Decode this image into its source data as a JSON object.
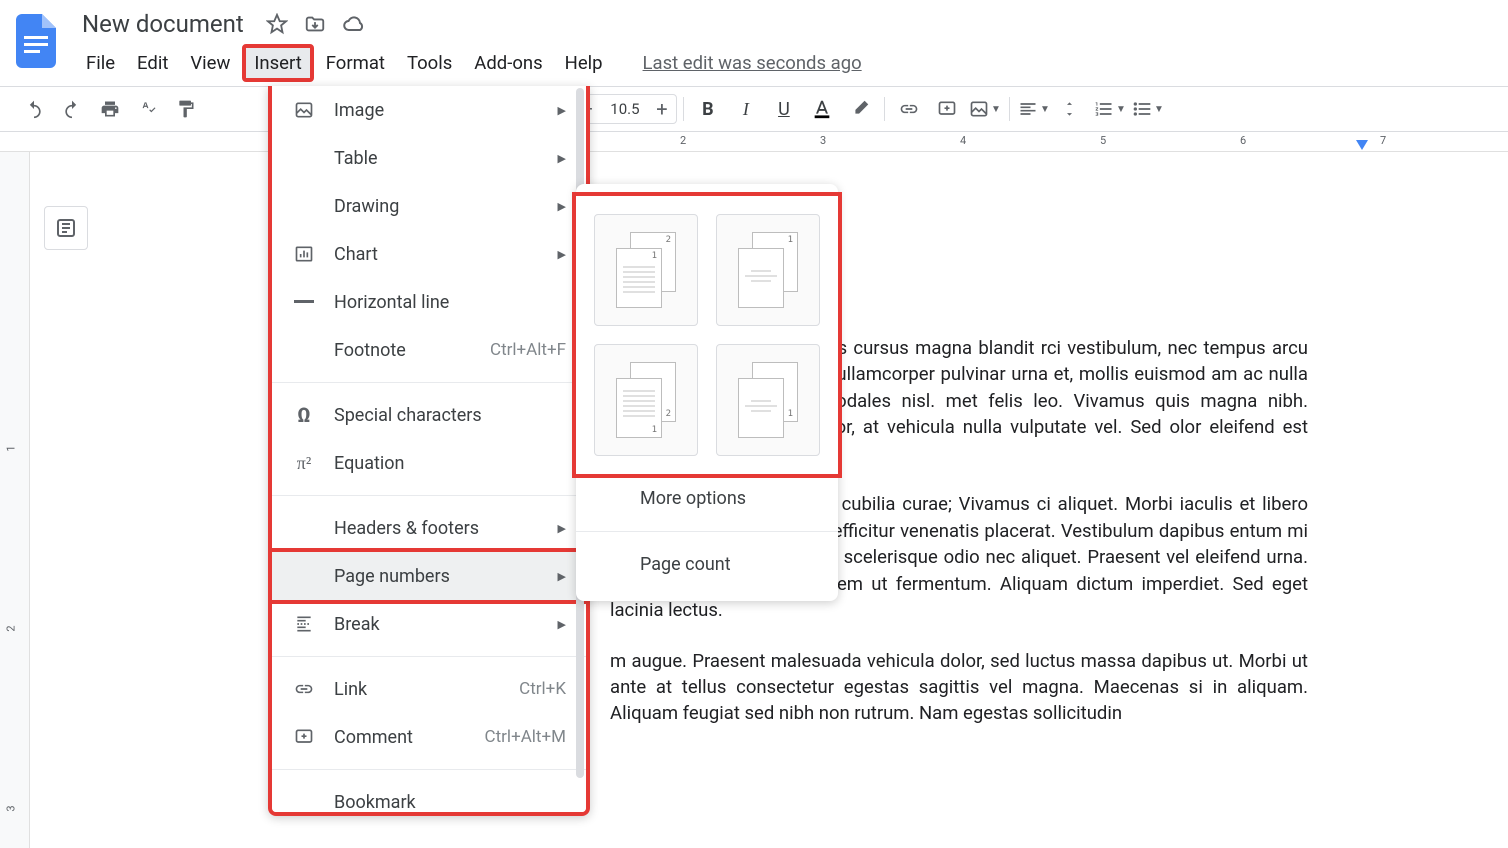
{
  "header": {
    "title": "New document",
    "last_edit": "Last edit was seconds ago"
  },
  "menus": {
    "file": "File",
    "edit": "Edit",
    "view": "View",
    "insert": "Insert",
    "format": "Format",
    "tools": "Tools",
    "addons": "Add-ons",
    "help": "Help"
  },
  "toolbar": {
    "font_size": "10.5"
  },
  "ruler": {
    "marks": [
      "2",
      "3",
      "4",
      "5",
      "6",
      "7"
    ]
  },
  "vruler": {
    "marks": [
      "1",
      "2",
      "3"
    ]
  },
  "insert_menu": {
    "image": "Image",
    "table": "Table",
    "drawing": "Drawing",
    "chart": "Chart",
    "horizontal_line": "Horizontal line",
    "footnote": "Footnote",
    "footnote_shortcut": "Ctrl+Alt+F",
    "special_chars": "Special characters",
    "equation": "Equation",
    "headers_footers": "Headers & footers",
    "page_numbers": "Page numbers",
    "break": "Break",
    "link": "Link",
    "link_shortcut": "Ctrl+K",
    "comment": "Comment",
    "comment_shortcut": "Ctrl+Alt+M",
    "bookmark": "Bookmark"
  },
  "submenu": {
    "more_options": "More options",
    "page_count": "Page count"
  },
  "document": {
    "p1": "iscing elit. Praesent rhoncus cursus magna blandit rci vestibulum, nec tempus arcu convallis. Praesent s nunc, ullamcorper pulvinar urna et, mollis euismod am ac nulla pharetra, finibus nisl id, sodales nisl. met felis leo. Vivamus quis magna nibh. Vestibulum rius varius tortor, at vehicula nulla vulputate vel. Sed olor eleifend est cursus lobortis non eu leo.",
    "p2": "i luctus et ultrices posuere cubilia curae; Vivamus ci aliquet. Morbi iaculis et libero nec ultrices. Sed non usce efficitur venenatis placerat. Vestibulum dapibus entum mi blandit in. Mauris imperdiet scelerisque odio nec aliquet. Praesent vel eleifend urna. Vivamus iaculis pharetra sem ut fermentum. Aliquam  dictum imperdiet. Sed eget lacinia lectus.",
    "p3": "m augue. Praesent malesuada vehicula dolor, sed luctus massa dapibus ut. Morbi ut ante at tellus consectetur egestas sagittis vel magna. Maecenas si in aliquam. Aliquam feugiat sed nibh non rutrum. Nam egestas sollicitudin"
  }
}
